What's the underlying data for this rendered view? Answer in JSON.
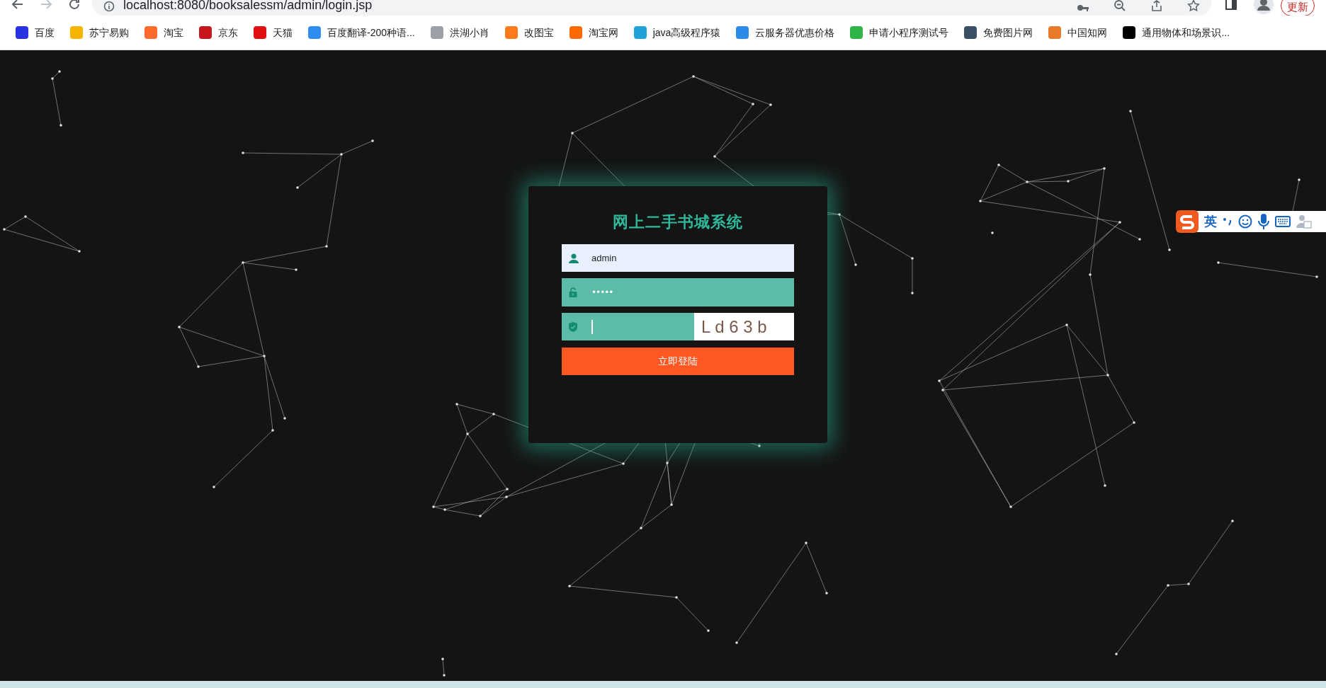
{
  "browser": {
    "url": "localhost:8080/booksalessm/admin/login.jsp",
    "update_button": "更新"
  },
  "bookmarks": [
    {
      "label": "百度",
      "color": "#2932e1"
    },
    {
      "label": "苏宁易购",
      "color": "#f5b400"
    },
    {
      "label": "淘宝",
      "color": "#ff6a2b"
    },
    {
      "label": "京东",
      "color": "#c8161d"
    },
    {
      "label": "天猫",
      "color": "#e01010"
    },
    {
      "label": "百度翻译-200种语...",
      "color": "#2f8cf0"
    },
    {
      "label": "洪湖小肖",
      "color": "#9aa0a6"
    },
    {
      "label": "改图宝",
      "color": "#ff7a1a"
    },
    {
      "label": "淘宝网",
      "color": "#ff6a00"
    },
    {
      "label": "java高级程序猿",
      "color": "#20a0d8"
    },
    {
      "label": "云服务器优惠价格",
      "color": "#2a8be8"
    },
    {
      "label": "申请小程序测试号",
      "color": "#2fb44a"
    },
    {
      "label": "免费图片网",
      "color": "#3c4f66"
    },
    {
      "label": "中国知网",
      "color": "#e87a2a"
    },
    {
      "label": "通用物体和场景识...",
      "color": "#000000"
    }
  ],
  "login": {
    "title": "网上二手书城系统",
    "username": "admin",
    "password": "•••••",
    "captcha_image": "L d 6 3 b",
    "submit": "立即登陆"
  },
  "ime": {
    "mode": "英"
  }
}
